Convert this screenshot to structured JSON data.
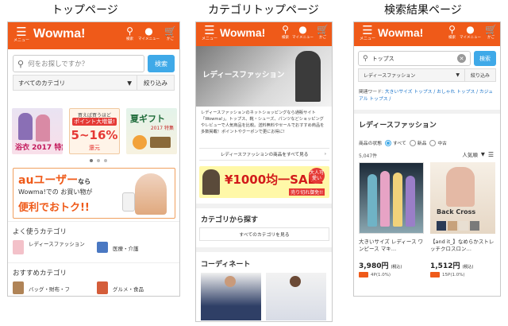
{
  "columns": {
    "top": "トップページ",
    "category": "カテゴリトップページ",
    "results": "検索結果ページ"
  },
  "header": {
    "logo": "Wowma!",
    "menu_label": "メニュー",
    "search_label": "検索",
    "mymenu_label": "マイメニュー",
    "cart_label": "かご"
  },
  "top": {
    "search_placeholder": "何をお探しですか？",
    "search_button": "検索",
    "category_select": "すべてのカテゴリ",
    "narrow_button": "絞り込み",
    "banner1_text": "浴衣 2017 特集",
    "banner2_line1": "買えば買うほど",
    "banner2_line2": "ポイント大増量!",
    "banner2_line3": "5~16%",
    "banner2_line4": "還元",
    "banner3_line1": "夏ギフト",
    "banner3_line2": "2017 特集",
    "au_line1": "auユーザー",
    "au_line2": "なら",
    "au_line3": "Wowma!での お買い物が",
    "au_line4": "便利でおトク!!",
    "fav_title": "よく使うカテゴリ",
    "fav_items": [
      "レディースファッション",
      "医療・介護"
    ],
    "rec_title": "おすすめカテゴリ",
    "rec_items": [
      "バッグ・財布・フ",
      "グルメ・食品"
    ]
  },
  "category": {
    "hero_title": "レディースファッション",
    "description": "レディースファッションのネットショッピングなら通販サイト「Wowma!」。トップス、靴・シューズ、パンツなどショッピングやレビューで人気商品を比較。送料無料やセールでおすすめ商品を多数掲載！ポイントやクーポンで更にお得に!",
    "see_all": "レディースファッションの商品をすべて見る",
    "sale_banner": "¥1000均一SALE",
    "sale_badge": "大人可愛い",
    "sale_sub": "売り切れ御免!!",
    "find_title": "カテゴリから探す",
    "find_link": "すべてのカテゴリを見る",
    "coord_title": "コーディネート"
  },
  "results": {
    "query": "トップス",
    "search_button": "検索",
    "category_select": "レディースファッション",
    "narrow_button": "絞り込み",
    "related_label": "関連ワード:",
    "related_words": "大きいサイズ トップス / おしゃれ トップス / カジュアル トップス /",
    "heading": "レディースファッション",
    "condition_label": "商品の状態",
    "cond_all": "すべて",
    "cond_new": "新品",
    "cond_used": "中古",
    "count": "5,047件",
    "sort": "人気順",
    "items": [
      {
        "name": "大きいサイズ レディース ワンピース マキ…",
        "price": "3,980円",
        "tax": "(税込)",
        "points": "4P(1.0%)"
      },
      {
        "name": "【and it_】なめらかストレッチクロスロン…",
        "price": "1,512円",
        "tax": "(税込)",
        "points": "15P(1.0%)"
      }
    ],
    "back_cross": "Back Cross"
  },
  "colors": {
    "brand_orange": "#ef5a19",
    "search_blue": "#3fa9e8",
    "link_blue": "#1a73c9"
  }
}
